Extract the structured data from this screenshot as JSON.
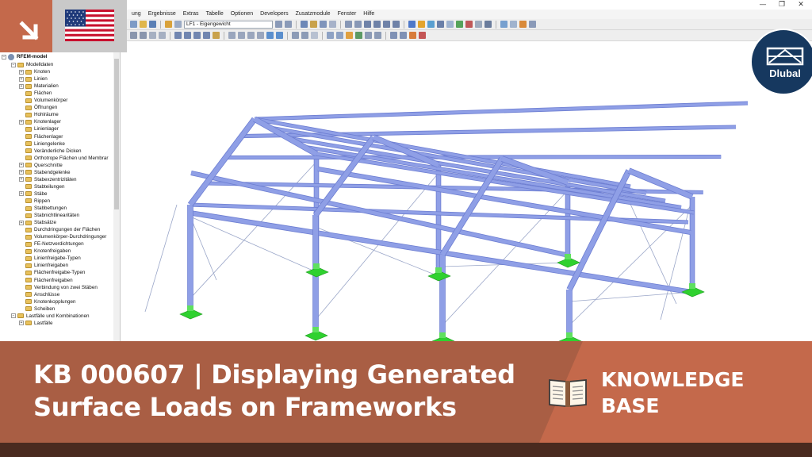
{
  "menu": [
    "ung",
    "Ergebnisse",
    "Extras",
    "Tabelle",
    "Optionen",
    "Developers",
    "Zusatzmodule",
    "Fenster",
    "Hilfe"
  ],
  "window_controls": {
    "minimize": "—",
    "maximize": "❐",
    "close": "✕"
  },
  "toolbar": {
    "load_case": "LF1 - Eigengewicht"
  },
  "navigator": {
    "root": "RFEM-model",
    "items": [
      {
        "label": "Modelldaten",
        "level": 1,
        "expander": "−"
      },
      {
        "label": "Knoten",
        "level": 2,
        "expander": "+"
      },
      {
        "label": "Linien",
        "level": 2,
        "expander": "+"
      },
      {
        "label": "Materialien",
        "level": 2,
        "expander": "+"
      },
      {
        "label": "Flächen",
        "level": 2,
        "expander": ""
      },
      {
        "label": "Volumenkörper",
        "level": 2,
        "expander": ""
      },
      {
        "label": "Öffnungen",
        "level": 2,
        "expander": ""
      },
      {
        "label": "Hohlräume",
        "level": 2,
        "expander": ""
      },
      {
        "label": "Knotenlager",
        "level": 2,
        "expander": "+"
      },
      {
        "label": "Linienlager",
        "level": 2,
        "expander": ""
      },
      {
        "label": "Flächenlager",
        "level": 2,
        "expander": ""
      },
      {
        "label": "Liniengelenke",
        "level": 2,
        "expander": ""
      },
      {
        "label": "Veränderliche Dicken",
        "level": 2,
        "expander": ""
      },
      {
        "label": "Orthotrope Flächen und Membrar",
        "level": 2,
        "expander": ""
      },
      {
        "label": "Querschnitte",
        "level": 2,
        "expander": "+"
      },
      {
        "label": "Stabendgelenke",
        "level": 2,
        "expander": "+"
      },
      {
        "label": "Stabexzentrizitäten",
        "level": 2,
        "expander": "+"
      },
      {
        "label": "Stabteilungen",
        "level": 2,
        "expander": ""
      },
      {
        "label": "Stäbe",
        "level": 2,
        "expander": "+"
      },
      {
        "label": "Rippen",
        "level": 2,
        "expander": ""
      },
      {
        "label": "Stabbettungen",
        "level": 2,
        "expander": ""
      },
      {
        "label": "Stabnichtlinearitäten",
        "level": 2,
        "expander": ""
      },
      {
        "label": "Stabsätze",
        "level": 2,
        "expander": "+"
      },
      {
        "label": "Durchdringungen der Flächen",
        "level": 2,
        "expander": ""
      },
      {
        "label": "Volumenkörper-Durchdringunger",
        "level": 2,
        "expander": ""
      },
      {
        "label": "FE-Netzverdichtungen",
        "level": 2,
        "expander": ""
      },
      {
        "label": "Knotenfreigaben",
        "level": 2,
        "expander": ""
      },
      {
        "label": "Linienfreigabe-Typen",
        "level": 2,
        "expander": ""
      },
      {
        "label": "Linienfreigaben",
        "level": 2,
        "expander": ""
      },
      {
        "label": "Flächenfreigabe-Typen",
        "level": 2,
        "expander": ""
      },
      {
        "label": "Flächenfreigaben",
        "level": 2,
        "expander": ""
      },
      {
        "label": "Verbindung von zwei Stäben",
        "level": 2,
        "expander": ""
      },
      {
        "label": "Anschlüsse",
        "level": 2,
        "expander": ""
      },
      {
        "label": "Knotenkopplungen",
        "level": 2,
        "expander": ""
      },
      {
        "label": "Scheiben",
        "level": 2,
        "expander": ""
      },
      {
        "label": "Lastfälle und Kombinationen",
        "level": 1,
        "expander": "−"
      },
      {
        "label": "Lastfälle",
        "level": 2,
        "expander": "+"
      }
    ]
  },
  "logo": {
    "text": "Dlubal"
  },
  "banner": {
    "title_line1": "KB 000607 | Displaying Generated",
    "title_line2": "Surface Loads on Frameworks",
    "kb_line1": "KNOWLEDGE",
    "kb_line2": "BASE"
  },
  "colors": {
    "banner_left": "#a95e44",
    "banner_right": "#c4694b",
    "banner_bottom_strip": "#4a2a1f",
    "member": "#8f9fe6",
    "member_edge": "#6d7ed2",
    "support": "#2fd12f",
    "logo_bg": "#16385f"
  }
}
